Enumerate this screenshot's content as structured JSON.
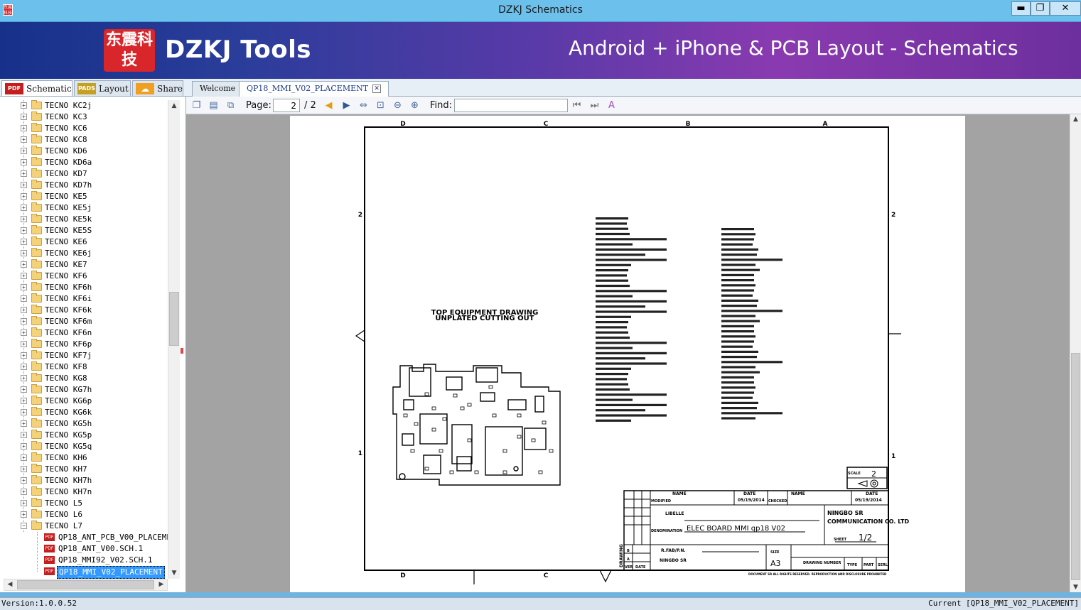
{
  "window": {
    "title": "DZKJ Schematics",
    "app_icon_text": "东震科技",
    "min_glyph": "▬",
    "max_glyph": "❐",
    "close_glyph": "✕"
  },
  "banner": {
    "logo_text": "东震科技",
    "brand": "DZKJ Tools",
    "tagline": "Android + iPhone & PCB Layout - Schematics"
  },
  "left_tabs": [
    {
      "label": "Schematic",
      "icon": "PDF",
      "icon_color": "#c41e1e"
    },
    {
      "label": "Layout",
      "icon": "PADS",
      "icon_color": "#c8a020"
    },
    {
      "label": "Share",
      "icon": "☁",
      "icon_color": "#f0a020"
    }
  ],
  "tree": {
    "folders": [
      "TECNO KC2j",
      "TECNO KC3",
      "TECNO KC6",
      "TECNO KC8",
      "TECNO KD6",
      "TECNO KD6a",
      "TECNO KD7",
      "TECNO KD7h",
      "TECNO KE5",
      "TECNO KE5j",
      "TECNO KE5k",
      "TECNO KE5S",
      "TECNO KE6",
      "TECNO KE6j",
      "TECNO KE7",
      "TECNO KF6",
      "TECNO KF6h",
      "TECNO KF6i",
      "TECNO KF6k",
      "TECNO KF6m",
      "TECNO KF6n",
      "TECNO KF6p",
      "TECNO KF7j",
      "TECNO KF8",
      "TECNO KG8",
      "TECNO KG7h",
      "TECNO KG6p",
      "TECNO KG6k",
      "TECNO KG5h",
      "TECNO KG5p",
      "TECNO KG5q",
      "TECNO KH6",
      "TECNO KH7",
      "TECNO KH7h",
      "TECNO KH7n",
      "TECNO L5",
      "TECNO L6",
      "TECNO L7"
    ],
    "files": [
      "QP18_ANT_PCB_V00_PLACEMENT",
      "QP18_ANT_V00.SCH.1",
      "QP18_MMI92_V02.SCH.1",
      "QP18_MMI_V02_PLACEMENT"
    ],
    "selected_file": "QP18_MMI_V02_PLACEMENT",
    "expand_glyph": "+",
    "collapse_glyph": "−",
    "pdf_badge": "PDF"
  },
  "doc_tabs": [
    {
      "label": "Welcome",
      "active": false
    },
    {
      "label": "QP18_MMI_V02_PLACEMENT",
      "active": true
    }
  ],
  "toolbar": {
    "page_label": "Page:",
    "page_current": "2",
    "page_total": "/ 2",
    "find_label": "Find:",
    "find_value": ""
  },
  "schematic": {
    "col_letters": [
      "D",
      "C",
      "B",
      "A"
    ],
    "row_numbers": [
      "2",
      "1"
    ],
    "title_lines": [
      "TOP EQUIPMENT DRAWING",
      "UNPLATED CUTTING OUT"
    ],
    "titleblock": {
      "name_label": "NAME",
      "date_label": "DATE",
      "date1": "05/19/2014",
      "checked_label": "CHECKED",
      "date2": "05/19/2014",
      "modified_label": "MODIFIED",
      "libelle_label": "LIBELLE",
      "denomination_label": "DENOMINATION",
      "denomination_value": "ELEC BOARD MMI qp18  V02",
      "company_line1": "NINGBO SR",
      "company_line2": "COMMUNICATION CO. LTD",
      "rfab_label": "R.FAB/P.N.",
      "ningbo": "NINGBO SR",
      "size_label": "SIZE",
      "size_value": "A3",
      "sheet_label": "SHEET",
      "sheet_value": "1/2",
      "scale_label": "SCALE",
      "scale_value": "2",
      "drawing_number_label": "DRAWING NUMBER",
      "type_label": "TYPE",
      "part_label": "PART",
      "serial_label": "SERL",
      "drawing_label": "DRAWING",
      "ver_label": "VER",
      "date_short": "DATE",
      "b_label": "B",
      "a_label": "A",
      "footer_note": "DOCUMENT SR ALL RIGHTS RESERVED. REPRODUCTION AND DISCLOSURE PROHIBITED"
    }
  },
  "status": {
    "version": "Version:1.0.0.52",
    "current": "Current [QP18_MMI_V02_PLACEMENT]"
  }
}
